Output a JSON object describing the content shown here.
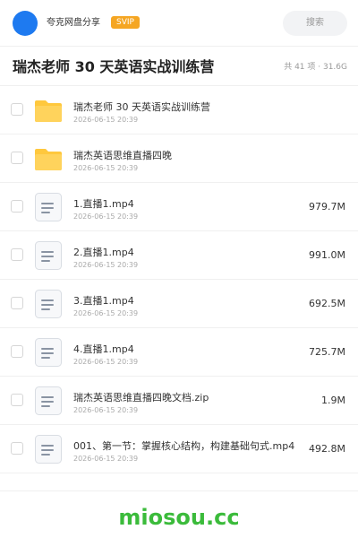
{
  "header": {
    "share_name": "夸克网盘分享",
    "badge": "SVIP",
    "search_placeholder": "搜索"
  },
  "title_bar": {
    "title": "瑞杰老师 30 天英语实战训练营",
    "summary": "共 41 项 · 31.6G"
  },
  "colors": {
    "accent_blue": "#1e7af0",
    "folder_yellow": "#ffc83d",
    "svip_orange": "#f5a623",
    "watermark_green": "#3bbb3b"
  },
  "files": [
    {
      "type": "folder",
      "icon": "folder-icon",
      "name": "瑞杰老师 30 天英语实战训练营",
      "date": "2026-06-15 20:39",
      "size": ""
    },
    {
      "type": "folder",
      "icon": "folder-icon",
      "name": "瑞杰英语思维直播四晚",
      "date": "2026-06-15 20:39",
      "size": ""
    },
    {
      "type": "file",
      "icon": "document-icon",
      "name": "1.直播1.mp4",
      "date": "2026-06-15 20:39",
      "size": "979.7M"
    },
    {
      "type": "file",
      "icon": "document-icon",
      "name": "2.直播1.mp4",
      "date": "2026-06-15 20:39",
      "size": "991.0M"
    },
    {
      "type": "file",
      "icon": "document-icon",
      "name": "3.直播1.mp4",
      "date": "2026-06-15 20:39",
      "size": "692.5M"
    },
    {
      "type": "file",
      "icon": "document-icon",
      "name": "4.直播1.mp4",
      "date": "2026-06-15 20:39",
      "size": "725.7M"
    },
    {
      "type": "file",
      "icon": "document-icon",
      "name": "瑞杰英语思维直播四晚文档.zip",
      "date": "2026-06-15 20:39",
      "size": "1.9M"
    },
    {
      "type": "file",
      "icon": "document-icon",
      "name": "001、第一节：掌握核心结构，构建基础句式.mp4",
      "date": "2026-06-15 20:39",
      "size": "492.8M"
    }
  ],
  "watermark": "miosou.cc"
}
